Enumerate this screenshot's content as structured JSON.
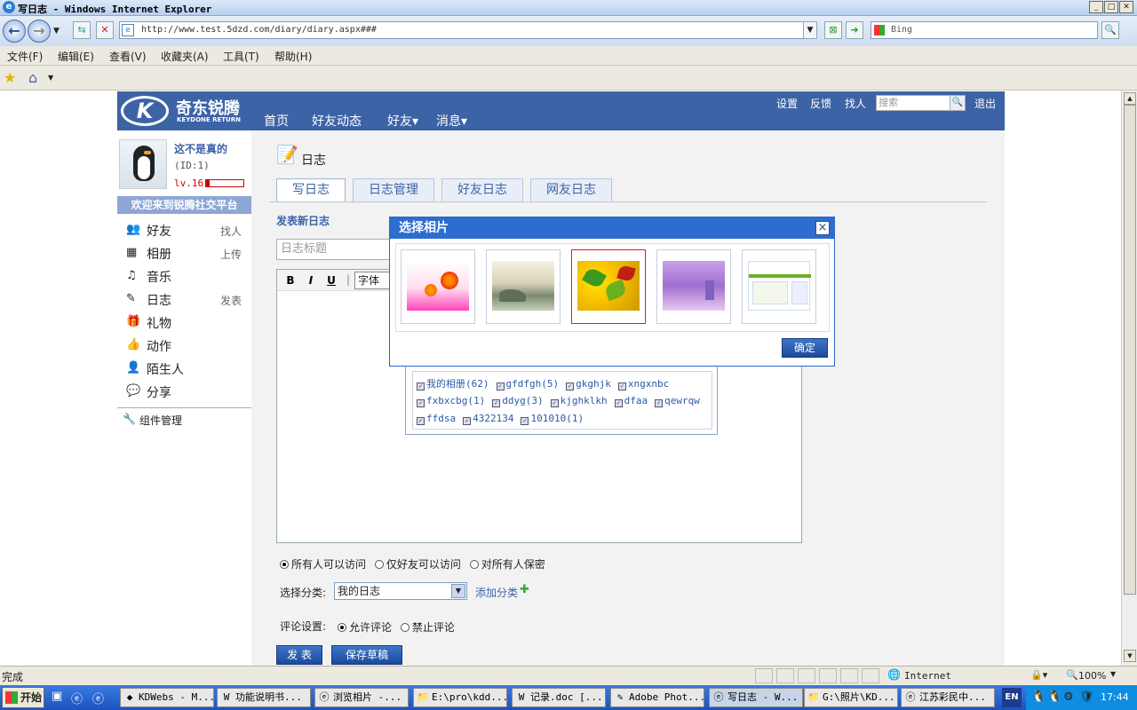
{
  "window": {
    "title": "写日志 - Windows Internet Explorer",
    "min": "_",
    "max": "□",
    "close": "✕"
  },
  "browser": {
    "url": "http://www.test.5dzd.com/diary/diary.aspx###",
    "search_placeholder": "Bing",
    "menu": [
      "文件(F)",
      "编辑(E)",
      "查看(V)",
      "收藏夹(A)",
      "工具(T)",
      "帮助(H)"
    ]
  },
  "site": {
    "logo_text": "奇东锐腾",
    "logo_sub": "KEYDONE RETURN",
    "nav": [
      "首页",
      "好友动态",
      "好友▾",
      "消息▾"
    ],
    "header_links": [
      "设置",
      "反馈",
      "找人"
    ],
    "search_placeholder": "搜索",
    "logout": "退出"
  },
  "profile": {
    "name": "这不是真的",
    "id": "(ID:1)",
    "level": "lv.16",
    "welcome": "欢迎来到锐腾社交平台"
  },
  "sidebar": [
    {
      "label": "好友",
      "action": "找人",
      "icon": "friends-icon",
      "glyph": "👥"
    },
    {
      "label": "相册",
      "action": "上传",
      "icon": "album-icon",
      "glyph": "▦"
    },
    {
      "label": "音乐",
      "action": "",
      "icon": "headphones-icon",
      "glyph": "♫"
    },
    {
      "label": "日志",
      "action": "发表",
      "icon": "diary-icon",
      "glyph": "✎"
    },
    {
      "label": "礼物",
      "action": "",
      "icon": "gift-icon",
      "glyph": "🎁"
    },
    {
      "label": "动作",
      "action": "",
      "icon": "thumb-icon",
      "glyph": "👍"
    },
    {
      "label": "陌生人",
      "action": "",
      "icon": "stranger-icon",
      "glyph": "👤"
    },
    {
      "label": "分享",
      "action": "",
      "icon": "share-icon",
      "glyph": "💬"
    }
  ],
  "widget_manage": "组件管理",
  "main": {
    "title": "日志",
    "tabs": [
      "写日志",
      "日志管理",
      "好友日志",
      "网友日志"
    ],
    "section": "发表新日志",
    "title_placeholder": "日志标题",
    "font_label": "字体",
    "toolbar": [
      "B",
      "I",
      "U"
    ]
  },
  "albums": [
    "我的相册(62)",
    "gfdfgh(5)",
    "gkghjk",
    "xngxnbc",
    "fxbxcbg(1)",
    "ddyg(3)",
    "kjghklkh",
    "dfaa",
    "qewrqw",
    "ffdsa",
    "4322134",
    "101010(1)"
  ],
  "privacy": {
    "options": [
      "所有人可以访问",
      "仅好友可以访问",
      "对所有人保密"
    ],
    "selected": 0
  },
  "category": {
    "label": "选择分类:",
    "value": "我的日志",
    "add": "添加分类"
  },
  "comment": {
    "label": "评论设置:",
    "options": [
      "允许评论",
      "禁止评论"
    ],
    "selected": 0
  },
  "buttons": {
    "publish": "发 表",
    "draft": "保存草稿"
  },
  "dialog": {
    "title": "选择相片",
    "confirm": "确定",
    "selected_index": 2
  },
  "status": {
    "text": "完成",
    "zone": "Internet",
    "zoom": "100%"
  },
  "taskbar": {
    "start": "开始",
    "lang": "EN",
    "clock": "17:44",
    "tasks": [
      "KDWebs - M...",
      "功能说明书...",
      "浏览相片 -...",
      "E:\\pro\\kdd...",
      "记录.doc [...",
      "Adobe Phot...",
      "写日志 - W...",
      "G:\\照片\\KD...",
      "江苏彩民中..."
    ]
  }
}
